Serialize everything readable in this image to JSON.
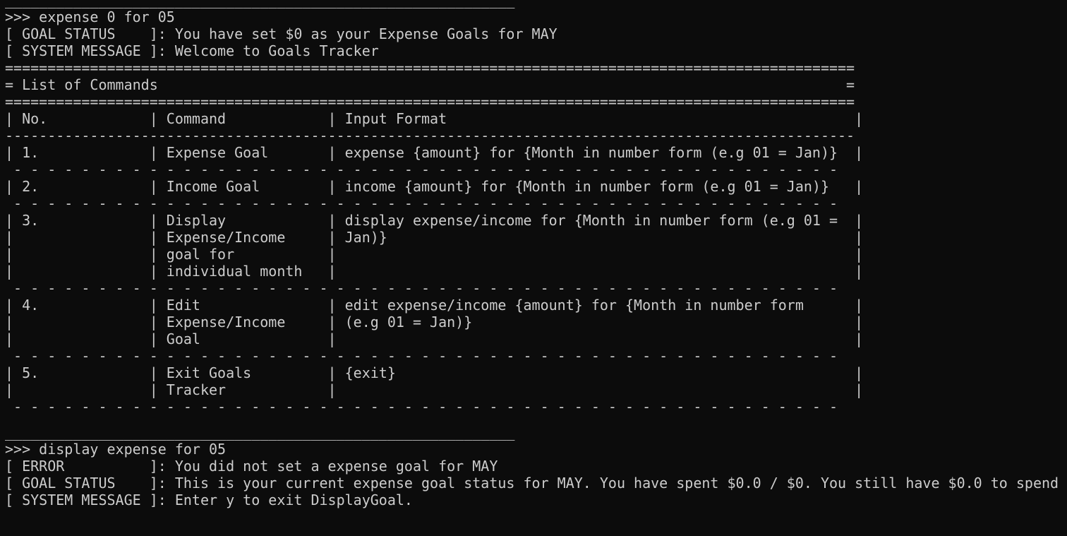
{
  "terminal": {
    "lines": [
      "____________________________________________________________",
      ">>> expense 0 for 05",
      "[ GOAL STATUS    ]: You have set $0 as your Expense Goals for MAY",
      "[ SYSTEM MESSAGE ]: Welcome to Goals Tracker",
      "====================================================================================================",
      "= List of Commands                                                                                 =",
      "====================================================================================================",
      "| No.            | Command            | Input Format                                                |",
      "----------------------------------------------------------------------------------------------------",
      "| 1.             | Expense Goal       | expense {amount} for {Month in number form (e.g 01 = Jan)}  |",
      " - - - - - - - - - - - - - - - - - - - - - - - - - - - - - - - - - - - - - - - - - - - - - - - - - ",
      "| 2.             | Income Goal        | income {amount} for {Month in number form (e.g 01 = Jan)}   |",
      " - - - - - - - - - - - - - - - - - - - - - - - - - - - - - - - - - - - - - - - - - - - - - - - - - ",
      "| 3.             | Display            | display expense/income for {Month in number form (e.g 01 =  |",
      "|                | Expense/Income     | Jan)}                                                       |",
      "|                | goal for           |                                                             |",
      "|                | individual month   |                                                             |",
      " - - - - - - - - - - - - - - - - - - - - - - - - - - - - - - - - - - - - - - - - - - - - - - - - - ",
      "| 4.             | Edit               | edit expense/income {amount} for {Month in number form      |",
      "|                | Expense/Income     | (e.g 01 = Jan)}                                             |",
      "|                | Goal               |                                                             |",
      " - - - - - - - - - - - - - - - - - - - - - - - - - - - - - - - - - - - - - - - - - - - - - - - - - ",
      "| 5.             | Exit Goals         | {exit}                                                      |",
      "|                | Tracker            |                                                             |",
      " - - - - - - - - - - - - - - - - - - - - - - - - - - - - - - - - - - - - - - - - - - - - - - - - - ",
      "",
      "____________________________________________________________",
      ">>> display expense for 05",
      "[ ERROR          ]: You did not set a expense goal for MAY",
      "[ GOAL STATUS    ]: This is your current expense goal status for MAY. You have spent $0.0 / $0. You still have $0.0 to spend",
      "[ SYSTEM MESSAGE ]: Enter y to exit DisplayGoal.",
      "",
      "____________________________________________________________"
    ],
    "prompt": ">>> "
  }
}
